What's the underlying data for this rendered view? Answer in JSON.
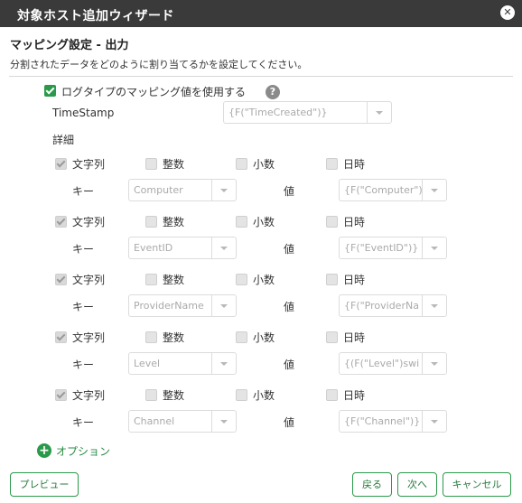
{
  "dialog": {
    "title": "対象ホスト追加ウィザード",
    "close_glyph": "✕"
  },
  "section": {
    "title": "マッピング設定 - 出力",
    "description": "分割されたデータをどのように割り当てるかを設定してください。"
  },
  "use_logtype_mapping": {
    "label": "ログタイプのマッピング値を使用する",
    "checked": true,
    "help_glyph": "?"
  },
  "timestamp": {
    "label": "TimeStamp",
    "value": "{F(\"TimeCreated\")}"
  },
  "details_label": "詳細",
  "type_options": {
    "string": "文字列",
    "integer": "整数",
    "decimal": "小数",
    "datetime": "日時"
  },
  "key_label": "キー",
  "value_label": "値",
  "mappings": [
    {
      "key": "Computer",
      "value": "{F(\"Computer\")}"
    },
    {
      "key": "EventID",
      "value": "{F(\"EventID\")}"
    },
    {
      "key": "ProviderName",
      "value": "{F(\"ProviderNa"
    },
    {
      "key": "Level",
      "value": "{(F(\"Level\")swi"
    },
    {
      "key": "Channel",
      "value": "{F(\"Channel\")}"
    }
  ],
  "option_link": "オプション",
  "buttons": {
    "preview": "プレビュー",
    "back": "戻る",
    "next": "次へ",
    "cancel": "キャンセル"
  }
}
